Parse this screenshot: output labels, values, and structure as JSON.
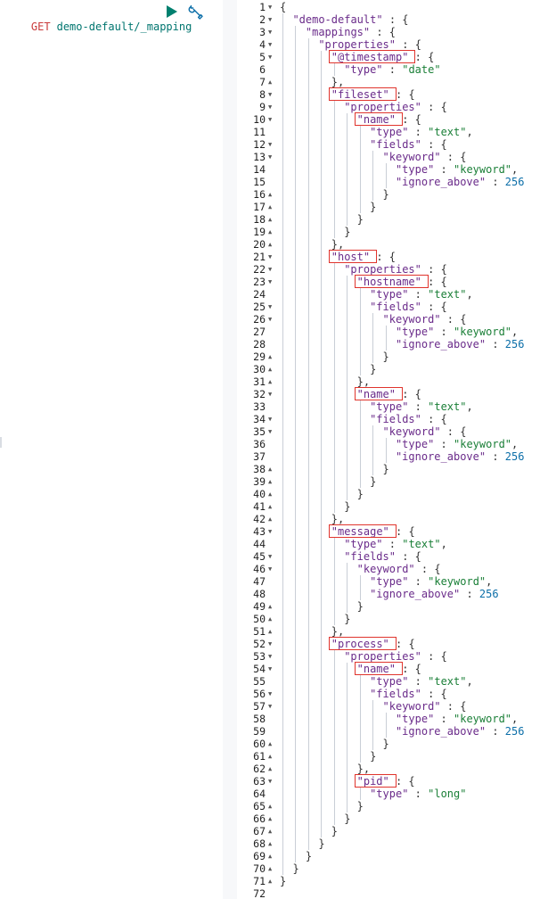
{
  "request": {
    "method": "GET",
    "url": "demo-default/_mapping",
    "run_icon": "play-icon",
    "settings_icon": "wrench-icon"
  },
  "response": {
    "lines": [
      {
        "n": 1,
        "i": 0,
        "f": "open",
        "t": [
          [
            "p",
            "{"
          ]
        ]
      },
      {
        "n": 2,
        "i": 1,
        "f": "open",
        "t": [
          [
            "k",
            "\"demo-default\""
          ],
          [
            "p",
            " : {"
          ]
        ]
      },
      {
        "n": 3,
        "i": 2,
        "f": "open",
        "t": [
          [
            "k",
            "\"mappings\""
          ],
          [
            "p",
            " : {"
          ]
        ]
      },
      {
        "n": 4,
        "i": 3,
        "f": "open",
        "t": [
          [
            "k",
            "\"properties\""
          ],
          [
            "p",
            " : {"
          ]
        ]
      },
      {
        "n": 5,
        "i": 4,
        "f": "open",
        "t": [
          [
            "k",
            "\"@timestamp\""
          ],
          [
            "p",
            " : {"
          ]
        ]
      },
      {
        "n": 6,
        "i": 5,
        "f": "",
        "t": [
          [
            "k",
            "\"type\""
          ],
          [
            "p",
            " : "
          ],
          [
            "s",
            "\"date\""
          ]
        ]
      },
      {
        "n": 7,
        "i": 4,
        "f": "close",
        "t": [
          [
            "p",
            "},"
          ]
        ]
      },
      {
        "n": 8,
        "i": 4,
        "f": "open",
        "t": [
          [
            "k",
            "\"fileset\""
          ],
          [
            "p",
            " : {"
          ]
        ]
      },
      {
        "n": 9,
        "i": 5,
        "f": "open",
        "t": [
          [
            "k",
            "\"properties\""
          ],
          [
            "p",
            " : {"
          ]
        ]
      },
      {
        "n": 10,
        "i": 6,
        "f": "open",
        "t": [
          [
            "k",
            "\"name\""
          ],
          [
            "p",
            " : {"
          ]
        ]
      },
      {
        "n": 11,
        "i": 7,
        "f": "",
        "t": [
          [
            "k",
            "\"type\""
          ],
          [
            "p",
            " : "
          ],
          [
            "s",
            "\"text\""
          ],
          [
            "p",
            ","
          ]
        ]
      },
      {
        "n": 12,
        "i": 7,
        "f": "open",
        "t": [
          [
            "k",
            "\"fields\""
          ],
          [
            "p",
            " : {"
          ]
        ]
      },
      {
        "n": 13,
        "i": 8,
        "f": "open",
        "t": [
          [
            "k",
            "\"keyword\""
          ],
          [
            "p",
            " : {"
          ]
        ]
      },
      {
        "n": 14,
        "i": 9,
        "f": "",
        "t": [
          [
            "k",
            "\"type\""
          ],
          [
            "p",
            " : "
          ],
          [
            "s",
            "\"keyword\""
          ],
          [
            "p",
            ","
          ]
        ]
      },
      {
        "n": 15,
        "i": 9,
        "f": "",
        "t": [
          [
            "k",
            "\"ignore_above\""
          ],
          [
            "p",
            " : "
          ],
          [
            "n",
            "256"
          ]
        ]
      },
      {
        "n": 16,
        "i": 8,
        "f": "close",
        "t": [
          [
            "p",
            "}"
          ]
        ]
      },
      {
        "n": 17,
        "i": 7,
        "f": "close",
        "t": [
          [
            "p",
            "}"
          ]
        ]
      },
      {
        "n": 18,
        "i": 6,
        "f": "close",
        "t": [
          [
            "p",
            "}"
          ]
        ]
      },
      {
        "n": 19,
        "i": 5,
        "f": "close",
        "t": [
          [
            "p",
            "}"
          ]
        ]
      },
      {
        "n": 20,
        "i": 4,
        "f": "close",
        "t": [
          [
            "p",
            "},"
          ]
        ]
      },
      {
        "n": 21,
        "i": 4,
        "f": "open",
        "t": [
          [
            "k",
            "\"host\""
          ],
          [
            "p",
            " : {"
          ]
        ]
      },
      {
        "n": 22,
        "i": 5,
        "f": "open",
        "t": [
          [
            "k",
            "\"properties\""
          ],
          [
            "p",
            " : {"
          ]
        ]
      },
      {
        "n": 23,
        "i": 6,
        "f": "open",
        "t": [
          [
            "k",
            "\"hostname\""
          ],
          [
            "p",
            " : {"
          ]
        ]
      },
      {
        "n": 24,
        "i": 7,
        "f": "",
        "t": [
          [
            "k",
            "\"type\""
          ],
          [
            "p",
            " : "
          ],
          [
            "s",
            "\"text\""
          ],
          [
            "p",
            ","
          ]
        ]
      },
      {
        "n": 25,
        "i": 7,
        "f": "open",
        "t": [
          [
            "k",
            "\"fields\""
          ],
          [
            "p",
            " : {"
          ]
        ]
      },
      {
        "n": 26,
        "i": 8,
        "f": "open",
        "t": [
          [
            "k",
            "\"keyword\""
          ],
          [
            "p",
            " : {"
          ]
        ]
      },
      {
        "n": 27,
        "i": 9,
        "f": "",
        "t": [
          [
            "k",
            "\"type\""
          ],
          [
            "p",
            " : "
          ],
          [
            "s",
            "\"keyword\""
          ],
          [
            "p",
            ","
          ]
        ]
      },
      {
        "n": 28,
        "i": 9,
        "f": "",
        "t": [
          [
            "k",
            "\"ignore_above\""
          ],
          [
            "p",
            " : "
          ],
          [
            "n",
            "256"
          ]
        ]
      },
      {
        "n": 29,
        "i": 8,
        "f": "close",
        "t": [
          [
            "p",
            "}"
          ]
        ]
      },
      {
        "n": 30,
        "i": 7,
        "f": "close",
        "t": [
          [
            "p",
            "}"
          ]
        ]
      },
      {
        "n": 31,
        "i": 6,
        "f": "close",
        "t": [
          [
            "p",
            "},"
          ]
        ]
      },
      {
        "n": 32,
        "i": 6,
        "f": "open",
        "t": [
          [
            "k",
            "\"name\""
          ],
          [
            "p",
            " : {"
          ]
        ]
      },
      {
        "n": 33,
        "i": 7,
        "f": "",
        "t": [
          [
            "k",
            "\"type\""
          ],
          [
            "p",
            " : "
          ],
          [
            "s",
            "\"text\""
          ],
          [
            "p",
            ","
          ]
        ]
      },
      {
        "n": 34,
        "i": 7,
        "f": "open",
        "t": [
          [
            "k",
            "\"fields\""
          ],
          [
            "p",
            " : {"
          ]
        ]
      },
      {
        "n": 35,
        "i": 8,
        "f": "open",
        "t": [
          [
            "k",
            "\"keyword\""
          ],
          [
            "p",
            " : {"
          ]
        ]
      },
      {
        "n": 36,
        "i": 9,
        "f": "",
        "t": [
          [
            "k",
            "\"type\""
          ],
          [
            "p",
            " : "
          ],
          [
            "s",
            "\"keyword\""
          ],
          [
            "p",
            ","
          ]
        ]
      },
      {
        "n": 37,
        "i": 9,
        "f": "",
        "t": [
          [
            "k",
            "\"ignore_above\""
          ],
          [
            "p",
            " : "
          ],
          [
            "n",
            "256"
          ]
        ]
      },
      {
        "n": 38,
        "i": 8,
        "f": "close",
        "t": [
          [
            "p",
            "}"
          ]
        ]
      },
      {
        "n": 39,
        "i": 7,
        "f": "close",
        "t": [
          [
            "p",
            "}"
          ]
        ]
      },
      {
        "n": 40,
        "i": 6,
        "f": "close",
        "t": [
          [
            "p",
            "}"
          ]
        ]
      },
      {
        "n": 41,
        "i": 5,
        "f": "close",
        "t": [
          [
            "p",
            "}"
          ]
        ]
      },
      {
        "n": 42,
        "i": 4,
        "f": "close",
        "t": [
          [
            "p",
            "},"
          ]
        ]
      },
      {
        "n": 43,
        "i": 4,
        "f": "open",
        "t": [
          [
            "k",
            "\"message\""
          ],
          [
            "p",
            " : {"
          ]
        ]
      },
      {
        "n": 44,
        "i": 5,
        "f": "",
        "t": [
          [
            "k",
            "\"type\""
          ],
          [
            "p",
            " : "
          ],
          [
            "s",
            "\"text\""
          ],
          [
            "p",
            ","
          ]
        ]
      },
      {
        "n": 45,
        "i": 5,
        "f": "open",
        "t": [
          [
            "k",
            "\"fields\""
          ],
          [
            "p",
            " : {"
          ]
        ]
      },
      {
        "n": 46,
        "i": 6,
        "f": "open",
        "t": [
          [
            "k",
            "\"keyword\""
          ],
          [
            "p",
            " : {"
          ]
        ]
      },
      {
        "n": 47,
        "i": 7,
        "f": "",
        "t": [
          [
            "k",
            "\"type\""
          ],
          [
            "p",
            " : "
          ],
          [
            "s",
            "\"keyword\""
          ],
          [
            "p",
            ","
          ]
        ]
      },
      {
        "n": 48,
        "i": 7,
        "f": "",
        "t": [
          [
            "k",
            "\"ignore_above\""
          ],
          [
            "p",
            " : "
          ],
          [
            "n",
            "256"
          ]
        ]
      },
      {
        "n": 49,
        "i": 6,
        "f": "close",
        "t": [
          [
            "p",
            "}"
          ]
        ]
      },
      {
        "n": 50,
        "i": 5,
        "f": "close",
        "t": [
          [
            "p",
            "}"
          ]
        ]
      },
      {
        "n": 51,
        "i": 4,
        "f": "close",
        "t": [
          [
            "p",
            "},"
          ]
        ]
      },
      {
        "n": 52,
        "i": 4,
        "f": "open",
        "t": [
          [
            "k",
            "\"process\""
          ],
          [
            "p",
            " : {"
          ]
        ]
      },
      {
        "n": 53,
        "i": 5,
        "f": "open",
        "t": [
          [
            "k",
            "\"properties\""
          ],
          [
            "p",
            " : {"
          ]
        ]
      },
      {
        "n": 54,
        "i": 6,
        "f": "open",
        "t": [
          [
            "k",
            "\"name\""
          ],
          [
            "p",
            " : {"
          ]
        ]
      },
      {
        "n": 55,
        "i": 7,
        "f": "",
        "t": [
          [
            "k",
            "\"type\""
          ],
          [
            "p",
            " : "
          ],
          [
            "s",
            "\"text\""
          ],
          [
            "p",
            ","
          ]
        ]
      },
      {
        "n": 56,
        "i": 7,
        "f": "open",
        "t": [
          [
            "k",
            "\"fields\""
          ],
          [
            "p",
            " : {"
          ]
        ]
      },
      {
        "n": 57,
        "i": 8,
        "f": "open",
        "t": [
          [
            "k",
            "\"keyword\""
          ],
          [
            "p",
            " : {"
          ]
        ]
      },
      {
        "n": 58,
        "i": 9,
        "f": "",
        "t": [
          [
            "k",
            "\"type\""
          ],
          [
            "p",
            " : "
          ],
          [
            "s",
            "\"keyword\""
          ],
          [
            "p",
            ","
          ]
        ]
      },
      {
        "n": 59,
        "i": 9,
        "f": "",
        "t": [
          [
            "k",
            "\"ignore_above\""
          ],
          [
            "p",
            " : "
          ],
          [
            "n",
            "256"
          ]
        ]
      },
      {
        "n": 60,
        "i": 8,
        "f": "close",
        "t": [
          [
            "p",
            "}"
          ]
        ]
      },
      {
        "n": 61,
        "i": 7,
        "f": "close",
        "t": [
          [
            "p",
            "}"
          ]
        ]
      },
      {
        "n": 62,
        "i": 6,
        "f": "close",
        "t": [
          [
            "p",
            "},"
          ]
        ]
      },
      {
        "n": 63,
        "i": 6,
        "f": "open",
        "t": [
          [
            "k",
            "\"pid\""
          ],
          [
            "p",
            " : {"
          ]
        ]
      },
      {
        "n": 64,
        "i": 7,
        "f": "",
        "t": [
          [
            "k",
            "\"type\""
          ],
          [
            "p",
            " : "
          ],
          [
            "s",
            "\"long\""
          ]
        ]
      },
      {
        "n": 65,
        "i": 6,
        "f": "close",
        "t": [
          [
            "p",
            "}"
          ]
        ]
      },
      {
        "n": 66,
        "i": 5,
        "f": "close",
        "t": [
          [
            "p",
            "}"
          ]
        ]
      },
      {
        "n": 67,
        "i": 4,
        "f": "close",
        "t": [
          [
            "p",
            "}"
          ]
        ]
      },
      {
        "n": 68,
        "i": 3,
        "f": "close",
        "t": [
          [
            "p",
            "}"
          ]
        ]
      },
      {
        "n": 69,
        "i": 2,
        "f": "close",
        "t": [
          [
            "p",
            "}"
          ]
        ]
      },
      {
        "n": 70,
        "i": 1,
        "f": "close",
        "t": [
          [
            "p",
            "}"
          ]
        ]
      },
      {
        "n": 71,
        "i": 0,
        "f": "close",
        "t": [
          [
            "p",
            "}"
          ]
        ]
      },
      {
        "n": 72,
        "i": 0,
        "f": "",
        "t": []
      }
    ],
    "highlighted_fields": [
      {
        "line": 5,
        "label": "@timestamp"
      },
      {
        "line": 8,
        "label": "fileset"
      },
      {
        "line": 10,
        "label": "name"
      },
      {
        "line": 21,
        "label": "host"
      },
      {
        "line": 23,
        "label": "hostname"
      },
      {
        "line": 32,
        "label": "name"
      },
      {
        "line": 43,
        "label": "message"
      },
      {
        "line": 52,
        "label": "process"
      },
      {
        "line": 54,
        "label": "name"
      },
      {
        "line": 63,
        "label": "pid"
      }
    ],
    "colors": {
      "key": "#6a2b8a",
      "string": "#1a7f37",
      "number": "#0b6ea8",
      "highlight_box": "#e0342d",
      "method": "#c93a3a",
      "url": "#00756f",
      "run_icon": "#00806f"
    }
  }
}
